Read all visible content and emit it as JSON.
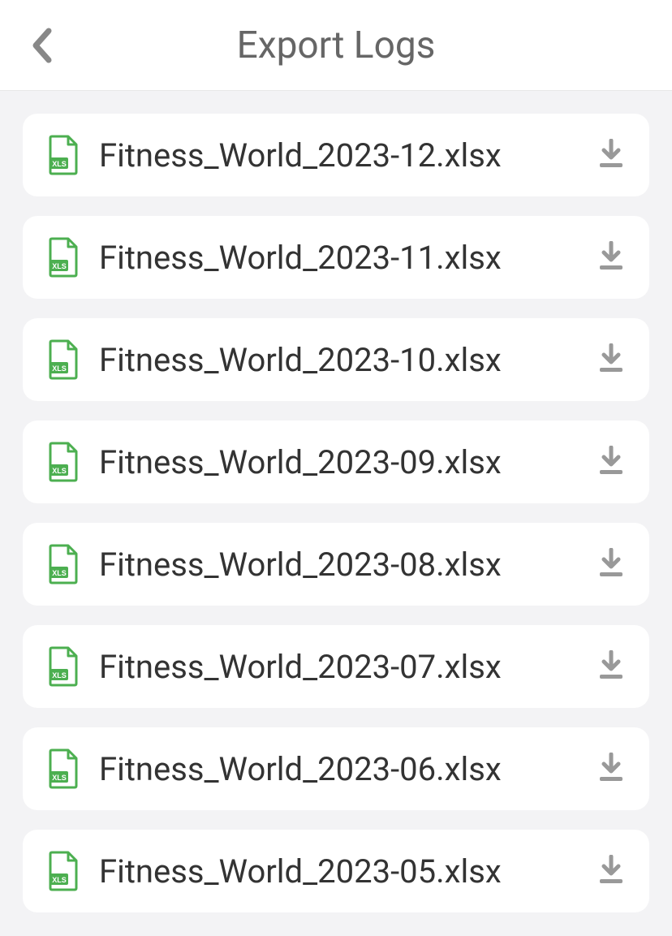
{
  "header": {
    "title": "Export Logs"
  },
  "files": [
    {
      "name": "Fitness_World_2023-12.xlsx"
    },
    {
      "name": "Fitness_World_2023-11.xlsx"
    },
    {
      "name": "Fitness_World_2023-10.xlsx"
    },
    {
      "name": "Fitness_World_2023-09.xlsx"
    },
    {
      "name": "Fitness_World_2023-08.xlsx"
    },
    {
      "name": "Fitness_World_2023-07.xlsx"
    },
    {
      "name": "Fitness_World_2023-06.xlsx"
    },
    {
      "name": "Fitness_World_2023-05.xlsx"
    }
  ],
  "colors": {
    "xlsGreen": "#4caf50",
    "downloadGray": "#999999",
    "chevronGray": "#888888"
  }
}
